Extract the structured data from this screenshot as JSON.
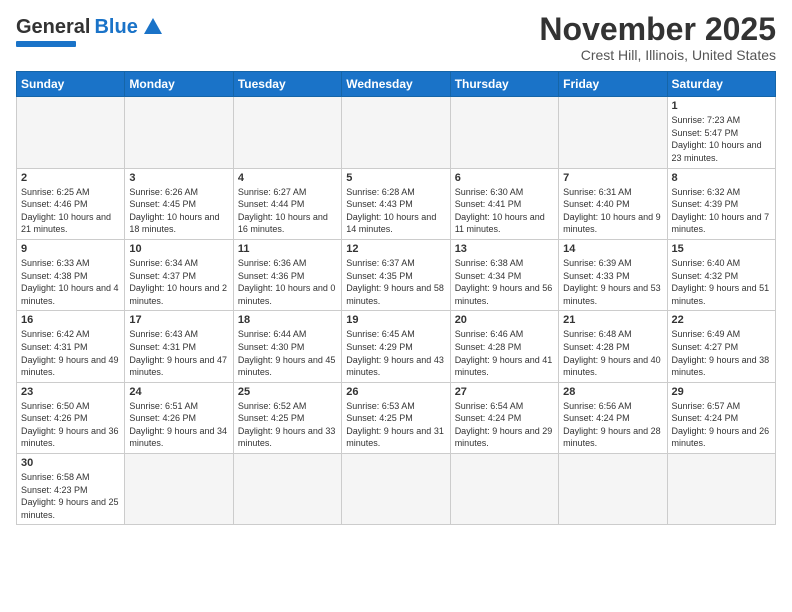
{
  "logo": {
    "text_general": "General",
    "text_blue": "Blue"
  },
  "header": {
    "month": "November 2025",
    "location": "Crest Hill, Illinois, United States"
  },
  "days_of_week": [
    "Sunday",
    "Monday",
    "Tuesday",
    "Wednesday",
    "Thursday",
    "Friday",
    "Saturday"
  ],
  "weeks": [
    [
      {
        "day": "",
        "empty": true
      },
      {
        "day": "",
        "empty": true
      },
      {
        "day": "",
        "empty": true
      },
      {
        "day": "",
        "empty": true
      },
      {
        "day": "",
        "empty": true
      },
      {
        "day": "",
        "empty": true
      },
      {
        "day": "1",
        "sunrise": "7:23 AM",
        "sunset": "5:47 PM",
        "daylight": "10 hours and 23 minutes."
      }
    ],
    [
      {
        "day": "2",
        "sunrise": "6:25 AM",
        "sunset": "4:46 PM",
        "daylight": "10 hours and 21 minutes."
      },
      {
        "day": "3",
        "sunrise": "6:26 AM",
        "sunset": "4:45 PM",
        "daylight": "10 hours and 18 minutes."
      },
      {
        "day": "4",
        "sunrise": "6:27 AM",
        "sunset": "4:44 PM",
        "daylight": "10 hours and 16 minutes."
      },
      {
        "day": "5",
        "sunrise": "6:28 AM",
        "sunset": "4:43 PM",
        "daylight": "10 hours and 14 minutes."
      },
      {
        "day": "6",
        "sunrise": "6:30 AM",
        "sunset": "4:41 PM",
        "daylight": "10 hours and 11 minutes."
      },
      {
        "day": "7",
        "sunrise": "6:31 AM",
        "sunset": "4:40 PM",
        "daylight": "10 hours and 9 minutes."
      },
      {
        "day": "8",
        "sunrise": "6:32 AM",
        "sunset": "4:39 PM",
        "daylight": "10 hours and 7 minutes."
      }
    ],
    [
      {
        "day": "9",
        "sunrise": "6:33 AM",
        "sunset": "4:38 PM",
        "daylight": "10 hours and 4 minutes."
      },
      {
        "day": "10",
        "sunrise": "6:34 AM",
        "sunset": "4:37 PM",
        "daylight": "10 hours and 2 minutes."
      },
      {
        "day": "11",
        "sunrise": "6:36 AM",
        "sunset": "4:36 PM",
        "daylight": "10 hours and 0 minutes."
      },
      {
        "day": "12",
        "sunrise": "6:37 AM",
        "sunset": "4:35 PM",
        "daylight": "9 hours and 58 minutes."
      },
      {
        "day": "13",
        "sunrise": "6:38 AM",
        "sunset": "4:34 PM",
        "daylight": "9 hours and 56 minutes."
      },
      {
        "day": "14",
        "sunrise": "6:39 AM",
        "sunset": "4:33 PM",
        "daylight": "9 hours and 53 minutes."
      },
      {
        "day": "15",
        "sunrise": "6:40 AM",
        "sunset": "4:32 PM",
        "daylight": "9 hours and 51 minutes."
      }
    ],
    [
      {
        "day": "16",
        "sunrise": "6:42 AM",
        "sunset": "4:31 PM",
        "daylight": "9 hours and 49 minutes."
      },
      {
        "day": "17",
        "sunrise": "6:43 AM",
        "sunset": "4:31 PM",
        "daylight": "9 hours and 47 minutes."
      },
      {
        "day": "18",
        "sunrise": "6:44 AM",
        "sunset": "4:30 PM",
        "daylight": "9 hours and 45 minutes."
      },
      {
        "day": "19",
        "sunrise": "6:45 AM",
        "sunset": "4:29 PM",
        "daylight": "9 hours and 43 minutes."
      },
      {
        "day": "20",
        "sunrise": "6:46 AM",
        "sunset": "4:28 PM",
        "daylight": "9 hours and 41 minutes."
      },
      {
        "day": "21",
        "sunrise": "6:48 AM",
        "sunset": "4:28 PM",
        "daylight": "9 hours and 40 minutes."
      },
      {
        "day": "22",
        "sunrise": "6:49 AM",
        "sunset": "4:27 PM",
        "daylight": "9 hours and 38 minutes."
      }
    ],
    [
      {
        "day": "23",
        "sunrise": "6:50 AM",
        "sunset": "4:26 PM",
        "daylight": "9 hours and 36 minutes."
      },
      {
        "day": "24",
        "sunrise": "6:51 AM",
        "sunset": "4:26 PM",
        "daylight": "9 hours and 34 minutes."
      },
      {
        "day": "25",
        "sunrise": "6:52 AM",
        "sunset": "4:25 PM",
        "daylight": "9 hours and 33 minutes."
      },
      {
        "day": "26",
        "sunrise": "6:53 AM",
        "sunset": "4:25 PM",
        "daylight": "9 hours and 31 minutes."
      },
      {
        "day": "27",
        "sunrise": "6:54 AM",
        "sunset": "4:24 PM",
        "daylight": "9 hours and 29 minutes."
      },
      {
        "day": "28",
        "sunrise": "6:56 AM",
        "sunset": "4:24 PM",
        "daylight": "9 hours and 28 minutes."
      },
      {
        "day": "29",
        "sunrise": "6:57 AM",
        "sunset": "4:24 PM",
        "daylight": "9 hours and 26 minutes."
      }
    ],
    [
      {
        "day": "30",
        "sunrise": "6:58 AM",
        "sunset": "4:23 PM",
        "daylight": "9 hours and 25 minutes."
      },
      {
        "day": "",
        "empty": true
      },
      {
        "day": "",
        "empty": true
      },
      {
        "day": "",
        "empty": true
      },
      {
        "day": "",
        "empty": true
      },
      {
        "day": "",
        "empty": true
      },
      {
        "day": "",
        "empty": true
      }
    ]
  ]
}
